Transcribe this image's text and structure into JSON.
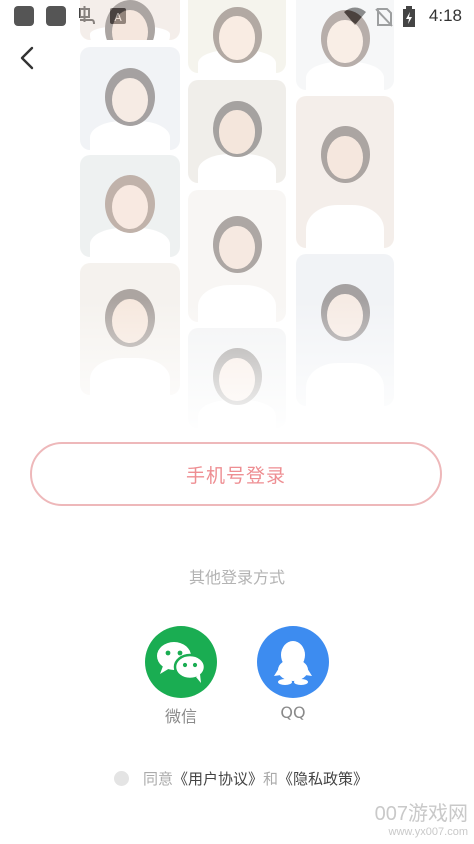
{
  "status_bar": {
    "time": "4:18"
  },
  "photos": [
    {
      "name": "photo-tile-1",
      "bg": "#e7d9cf",
      "skin": "#e9c7b3",
      "hair": "#3a2a24"
    },
    {
      "name": "photo-tile-2",
      "bg": "#dfe3ea",
      "skin": "#ecd0c0",
      "hair": "#2b2222"
    },
    {
      "name": "photo-tile-3",
      "bg": "#d9dfe0",
      "skin": "#f0cbb8",
      "hair": "#6b4a36"
    },
    {
      "name": "photo-tile-4",
      "bg": "#e9e2d8",
      "skin": "#eccab2",
      "hair": "#3c2b22"
    },
    {
      "name": "photo-tile-5",
      "bg": "#e8e6d6",
      "skin": "#f1d3bd",
      "hair": "#4a3526"
    },
    {
      "name": "photo-tile-6",
      "bg": "#dcd7cf",
      "skin": "#e6c4ae",
      "hair": "#2c2420"
    },
    {
      "name": "photo-tile-7",
      "bg": "#f0ece6",
      "skin": "#eccdb9",
      "hair": "#3e3029"
    },
    {
      "name": "photo-tile-8",
      "bg": "#e4e6e9",
      "skin": "#f0d4c2",
      "hair": "#332a26"
    },
    {
      "name": "photo-tile-9",
      "bg": "#eaeef0",
      "skin": "#f1d7c6",
      "hair": "#564036"
    }
  ],
  "login": {
    "phone_button": "手机号登录"
  },
  "other_methods": {
    "title": "其他登录方式",
    "wechat_label": "微信",
    "qq_label": "QQ"
  },
  "agreement": {
    "prefix": "同意",
    "user_agreement": "《用户协议》",
    "and": "和",
    "privacy_policy": "《隐私政策》"
  },
  "watermark": {
    "line1": "007游戏网",
    "line2": "www.yx007.com"
  },
  "colors": {
    "accent": "#ee8e92",
    "wechat": "#1aad52",
    "qq": "#3d8cf0"
  }
}
